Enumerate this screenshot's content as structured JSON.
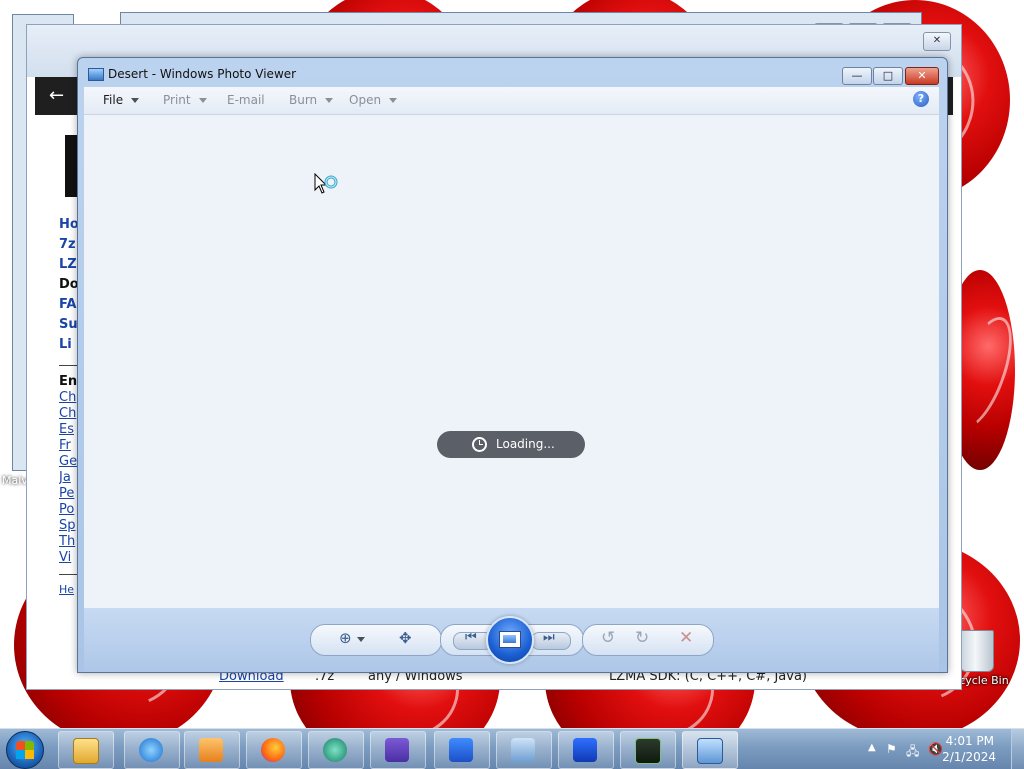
{
  "photo_viewer": {
    "title": "Desert - Windows Photo Viewer",
    "menu": {
      "file": "File",
      "print": "Print",
      "email": "E-mail",
      "burn": "Burn",
      "open": "Open",
      "help": "?"
    },
    "loading_text": "Loading...",
    "controls": {
      "minimize": "—",
      "maximize": "□",
      "close": "✕"
    }
  },
  "browser": {
    "back_glyph": "←",
    "sidebar_links": [
      "Ho",
      "7z",
      "LZ",
      "Do",
      "FA",
      "Su",
      "Li"
    ],
    "sidebar_heading": "En",
    "sidebar_small_links": [
      "Ch",
      "Ch",
      "Es",
      "Fr",
      "Ge",
      "Ja",
      "Pe",
      "Po",
      "Sp",
      "Th",
      "Vi"
    ],
    "footer_link": "He",
    "bottom_row": {
      "download": "Download",
      "ext": ".7z",
      "platform": "any / Windows",
      "sdk": "LZMA SDK: (C, C++, C#, Java)"
    }
  },
  "desktop": {
    "recycle_bin": "Recycle Bin",
    "malw": "Malv"
  },
  "taskbar": {
    "time": "4:01 PM",
    "date": "2/1/2024"
  }
}
